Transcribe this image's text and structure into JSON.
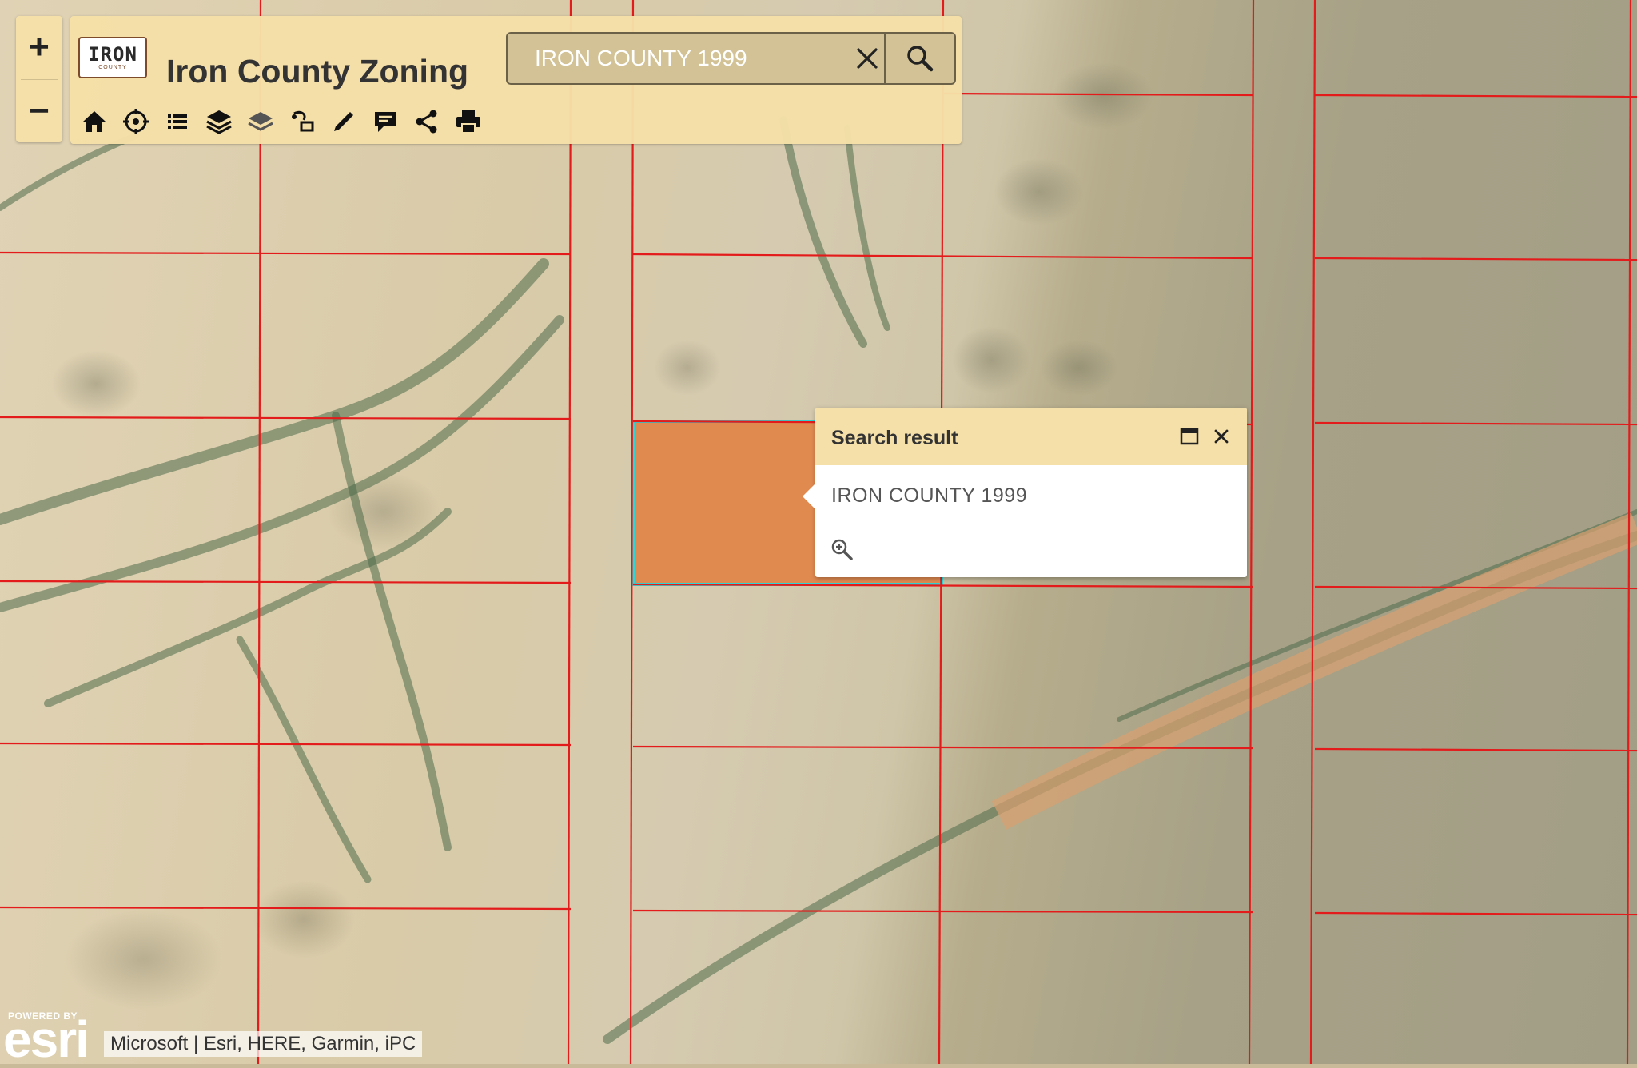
{
  "app": {
    "title": "Iron County Zoning",
    "logo_text": "IRON",
    "logo_subtext": "COUNTY"
  },
  "zoom": {
    "in_label": "+",
    "out_label": "−"
  },
  "search": {
    "value": "IRON COUNTY 1999",
    "placeholder": "IRON COUNTY 1999"
  },
  "toolbar": {
    "tools": [
      "home-icon",
      "locate-icon",
      "legend-icon",
      "layer-list-icon",
      "basemap-icon",
      "measure-icon",
      "draw-icon",
      "comment-icon",
      "share-icon",
      "print-icon"
    ]
  },
  "popup": {
    "title": "Search result",
    "content": "IRON COUNTY 1999"
  },
  "attribution": {
    "powered_by": "POWERED BY",
    "esri": "esri",
    "text": "Microsoft | Esri, HERE, Garmin, iPC"
  },
  "colors": {
    "panel": "#f5e0a9",
    "parcel_lines": "#e31b1b",
    "selected_fill": "#e08a50",
    "selected_outline": "#2fd6d6"
  }
}
